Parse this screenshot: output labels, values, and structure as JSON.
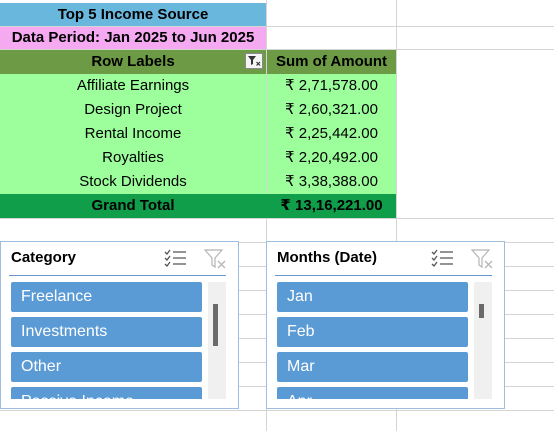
{
  "sheet": {
    "title": "Top 5 Income Source",
    "period": "Data Period: Jan 2025 to Jun 2025"
  },
  "pivot": {
    "header": {
      "row_labels": "Row Labels",
      "value": "Sum of Amount"
    },
    "rows": [
      {
        "label": "Affiliate Earnings",
        "amount": "₹ 2,71,578.00"
      },
      {
        "label": "Design Project",
        "amount": "₹ 2,60,321.00"
      },
      {
        "label": "Rental Income",
        "amount": "₹ 2,25,442.00"
      },
      {
        "label": "Royalties",
        "amount": "₹ 2,20,492.00"
      },
      {
        "label": "Stock Dividends",
        "amount": "₹ 3,38,388.00"
      }
    ],
    "total": {
      "label": "Grand Total",
      "amount": "₹ 13,16,221.00"
    }
  },
  "slicers": {
    "category": {
      "title": "Category",
      "items": [
        "Freelance",
        "Investments",
        "Other",
        "Passive Income"
      ]
    },
    "months": {
      "title": "Months (Date)",
      "items": [
        "Jan",
        "Feb",
        "Mar",
        "Apr"
      ]
    }
  },
  "colors": {
    "title_fill": "#6ab7dd",
    "period_fill": "#f5a9f1",
    "header_fill": "#6d9b45",
    "body_fill": "#9cff9c",
    "total_fill": "#119e4a",
    "slicer_item": "#5b9bd5"
  }
}
